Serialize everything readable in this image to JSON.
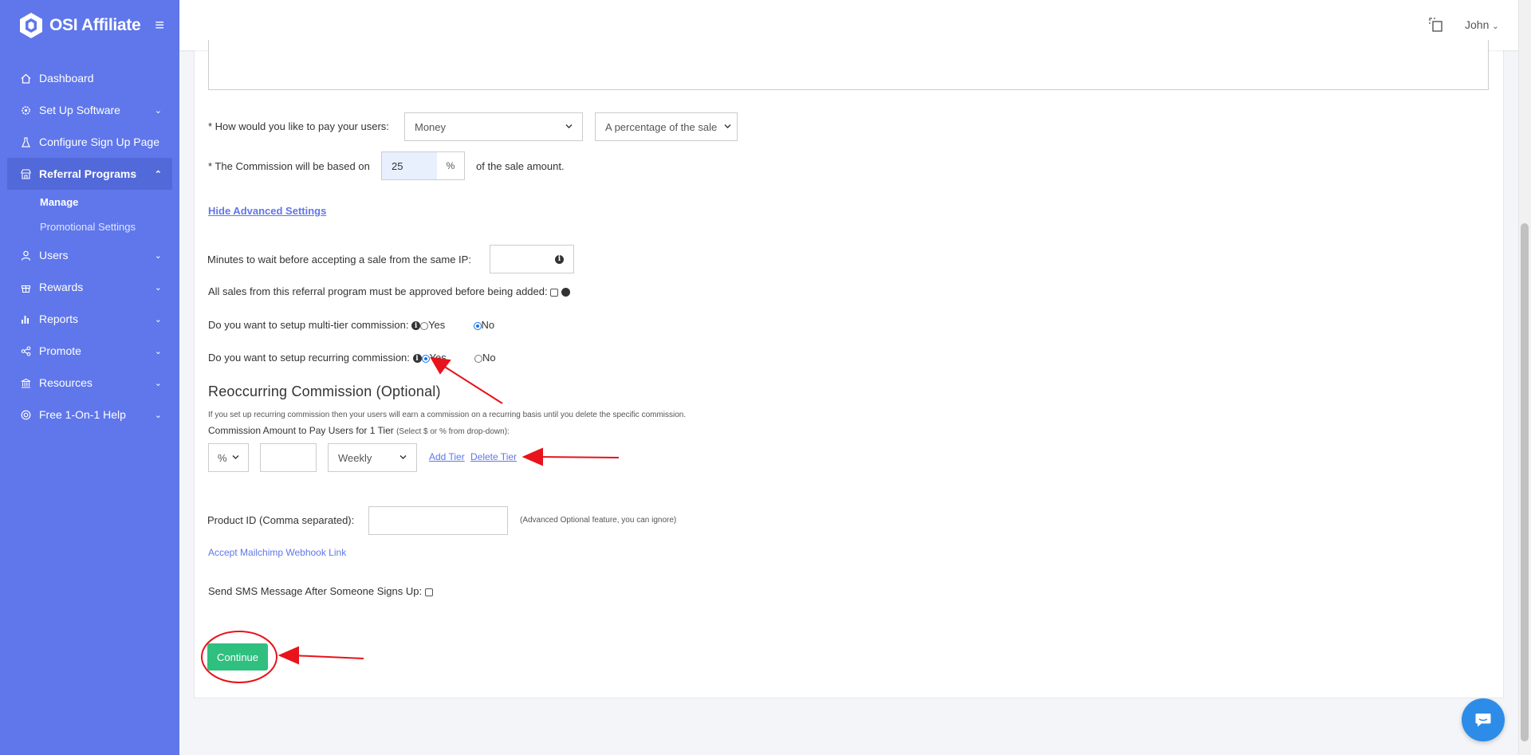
{
  "brand": {
    "name": "OSI Affiliate",
    "logo_icon": "hexagon-logo-icon",
    "menu_icon": "hamburger-icon"
  },
  "sidebar": {
    "items": [
      {
        "label": "Dashboard",
        "icon": "home-icon"
      },
      {
        "label": "Set Up Software",
        "icon": "gear-icon"
      },
      {
        "label": "Configure Sign Up Page",
        "icon": "flask-icon"
      },
      {
        "label": "Referral Programs",
        "icon": "store-icon",
        "expanded": true
      },
      {
        "label": "Users",
        "icon": "user-icon"
      },
      {
        "label": "Rewards",
        "icon": "gift-icon"
      },
      {
        "label": "Reports",
        "icon": "bar-chart-icon"
      },
      {
        "label": "Promote",
        "icon": "share-icon"
      },
      {
        "label": "Resources",
        "icon": "bank-icon"
      },
      {
        "label": "Free 1-On-1 Help",
        "icon": "lifebuoy-icon"
      }
    ],
    "sub_items": [
      {
        "label": "Manage"
      },
      {
        "label": "Promotional Settings"
      }
    ]
  },
  "topbar": {
    "user": "John"
  },
  "form": {
    "pay_label": "* How would you like to pay your users:",
    "pay_method": "Money",
    "pay_type": "A percentage of the sale",
    "commission_label": "* The Commission will be based on",
    "commission_value": "25",
    "commission_unit": "%",
    "commission_suffix": "of the sale amount.",
    "hide_advanced": "Hide Advanced Settings",
    "minutes_label": "Minutes to wait before accepting a sale from the same IP:",
    "approve_label": "All sales from this referral program must be approved before being added:",
    "multitier_label": "Do you want to setup multi-tier commission:",
    "multitier_selected": "No",
    "recurring_label": "Do you want to setup recurring commission:",
    "recurring_selected": "Yes",
    "yes": "Yes",
    "no": "No",
    "recurring_title": "Reoccurring Commission (Optional)",
    "recurring_desc": "If you set up recurring commission then your users will earn a commission on a recurring basis until you delete the specific commission.",
    "tier_label": "Commission Amount to Pay Users for 1 Tier",
    "tier_hint": "(Select $ or % from drop-down):",
    "tier_unit": "%",
    "tier_frequency": "Weekly",
    "add_tier": "Add Tier",
    "delete_tier": "Delete Tier",
    "product_label": "Product ID (Comma separated):",
    "product_hint": "(Advanced Optional feature, you can ignore)",
    "mailchimp_link": "Accept Mailchimp Webhook Link",
    "sms_label": "Send SMS Message After Someone Signs Up:",
    "continue": "Continue"
  },
  "colors": {
    "sidebar": "#5f77ea",
    "accent": "#2fbf7f",
    "annotation": "#e8131b",
    "link": "#5f77ea"
  }
}
